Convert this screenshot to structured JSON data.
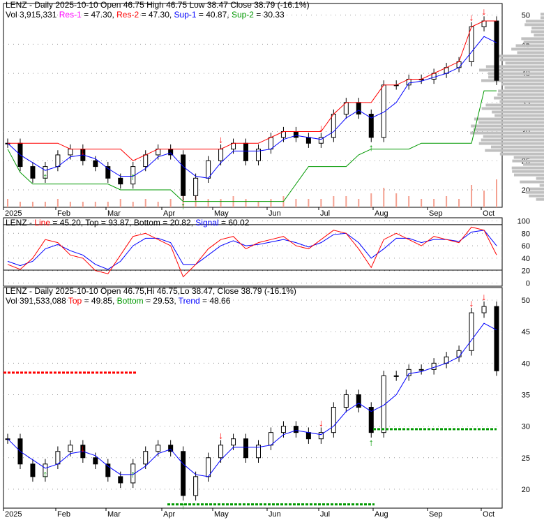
{
  "chart_data": [
    {
      "type": "candlestick",
      "title": "LENZ - Daily 2025-10-10 Open 46.75  High 46.75  Low 38.47  Close 38.79 (-16.1%)",
      "legend": {
        "vol": "Vol 3,915,331",
        "res1": "Res-1",
        "res1_val": " = 47.30, ",
        "res2": "Res-2",
        "res2_val": " = 47.30, ",
        "sup1": "Sup-1",
        "sup1_val": " = 40.87, ",
        "sup2": "Sup-2",
        "sup2_val": " = 30.33"
      },
      "yticks": [
        20,
        25,
        30,
        35,
        40,
        45,
        50
      ],
      "ylim": [
        17,
        52
      ],
      "xticks": [
        "2025",
        "Feb",
        "Mar",
        "Apr",
        "May",
        "Jun",
        "Jul",
        "Aug",
        "Sep",
        "Oct"
      ],
      "closes": [
        28,
        24,
        22,
        24,
        26,
        27,
        25,
        24,
        22,
        21,
        24,
        26,
        27,
        26,
        19,
        22,
        25,
        27,
        28,
        25,
        27,
        29,
        30,
        29,
        28,
        29,
        33,
        35,
        33,
        29,
        38,
        38,
        39,
        39,
        40,
        41,
        42,
        48,
        49,
        38.79
      ],
      "volume": [
        3,
        2,
        2,
        2,
        3,
        2,
        2,
        2,
        2,
        3,
        2,
        3,
        2,
        3,
        6,
        4,
        3,
        3,
        4,
        3,
        2,
        3,
        4,
        3,
        3,
        3,
        4,
        4,
        3,
        5,
        7,
        5,
        4,
        3,
        3,
        4,
        3,
        8,
        6,
        10
      ]
    },
    {
      "type": "line",
      "title_prefix": "LENZ - ",
      "line_label": "Line",
      "mid": " = 45.20, Top = 93.87, Bottom = 20.82, ",
      "signal_label": "Signal",
      "signal_val": " = 60.02",
      "yticks": [
        0,
        20,
        40,
        60,
        80,
        100
      ],
      "ylim": [
        0,
        100
      ],
      "line": [
        30,
        22,
        40,
        70,
        65,
        45,
        40,
        20,
        15,
        45,
        75,
        80,
        70,
        60,
        10,
        30,
        55,
        70,
        75,
        55,
        65,
        70,
        75,
        60,
        55,
        70,
        85,
        80,
        55,
        25,
        70,
        80,
        70,
        60,
        75,
        70,
        65,
        90,
        85,
        45.2
      ],
      "signal": [
        35,
        28,
        35,
        55,
        62,
        52,
        45,
        30,
        22,
        35,
        60,
        72,
        72,
        65,
        30,
        30,
        45,
        60,
        68,
        60,
        62,
        66,
        70,
        65,
        58,
        65,
        78,
        80,
        65,
        40,
        55,
        72,
        72,
        65,
        70,
        70,
        67,
        82,
        85,
        60.02
      ]
    },
    {
      "type": "candlestick",
      "title": "LENZ - Daily 2025-10-10 Open 46.75,Hi 46.75,Lo 38.47, Close 38.79 (-16.1%)",
      "legend": {
        "vol": "Vol 391,533,088 ",
        "top": "Top",
        "top_val": " = 49.85, ",
        "bottom": "Bottom",
        "bottom_val": " = 29.53, ",
        "trend": "Trend",
        "trend_val": " = 48.66"
      },
      "yticks": [
        20,
        25,
        30,
        35,
        40,
        45,
        50
      ],
      "ylim": [
        17,
        52
      ],
      "xticks": [
        "2025",
        "Feb",
        "Mar",
        "Apr",
        "May",
        "Jun",
        "Jul",
        "Aug",
        "Sep",
        "Oct"
      ]
    }
  ],
  "colors": {
    "up": "#000000",
    "res1": "#ff00ff",
    "res2": "#ff0000",
    "sup1": "#0000ff",
    "sup2": "#009900",
    "volume": "#f4a090",
    "profile": "#c0c0c0"
  }
}
